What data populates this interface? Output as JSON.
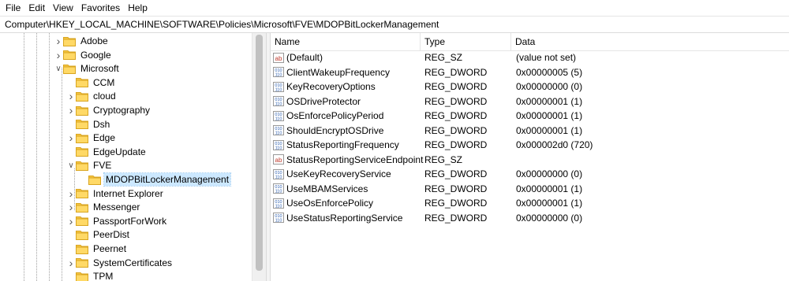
{
  "menu": [
    "File",
    "Edit",
    "View",
    "Favorites",
    "Help"
  ],
  "address": "Computer\\HKEY_LOCAL_MACHINE\\SOFTWARE\\Policies\\Microsoft\\FVE\\MDOPBitLockerManagement",
  "tree": [
    {
      "label": "Adobe",
      "level": 0,
      "expander": "collapsed"
    },
    {
      "label": "Google",
      "level": 0,
      "expander": "collapsed"
    },
    {
      "label": "Microsoft",
      "level": 0,
      "expander": "expanded"
    },
    {
      "label": "CCM",
      "level": 1,
      "expander": "none"
    },
    {
      "label": "cloud",
      "level": 1,
      "expander": "collapsed"
    },
    {
      "label": "Cryptography",
      "level": 1,
      "expander": "collapsed"
    },
    {
      "label": "Dsh",
      "level": 1,
      "expander": "none"
    },
    {
      "label": "Edge",
      "level": 1,
      "expander": "collapsed"
    },
    {
      "label": "EdgeUpdate",
      "level": 1,
      "expander": "none"
    },
    {
      "label": "FVE",
      "level": 1,
      "expander": "expanded"
    },
    {
      "label": "MDOPBitLockerManagement",
      "level": 2,
      "expander": "none",
      "selected": true
    },
    {
      "label": "Internet Explorer",
      "level": 1,
      "expander": "collapsed"
    },
    {
      "label": "Messenger",
      "level": 1,
      "expander": "collapsed"
    },
    {
      "label": "PassportForWork",
      "level": 1,
      "expander": "collapsed"
    },
    {
      "label": "PeerDist",
      "level": 1,
      "expander": "none"
    },
    {
      "label": "Peernet",
      "level": 1,
      "expander": "none"
    },
    {
      "label": "SystemCertificates",
      "level": 1,
      "expander": "collapsed"
    },
    {
      "label": "TPM",
      "level": 1,
      "expander": "none"
    }
  ],
  "columns": [
    "Name",
    "Type",
    "Data"
  ],
  "values": [
    {
      "name": "(Default)",
      "type": "REG_SZ",
      "data": "(value not set)",
      "icon": "string-value-icon"
    },
    {
      "name": "ClientWakeupFrequency",
      "type": "REG_DWORD",
      "data": "0x00000005 (5)",
      "icon": "binary-value-icon"
    },
    {
      "name": "KeyRecoveryOptions",
      "type": "REG_DWORD",
      "data": "0x00000000 (0)",
      "icon": "binary-value-icon"
    },
    {
      "name": "OSDriveProtector",
      "type": "REG_DWORD",
      "data": "0x00000001 (1)",
      "icon": "binary-value-icon"
    },
    {
      "name": "OsEnforcePolicyPeriod",
      "type": "REG_DWORD",
      "data": "0x00000001 (1)",
      "icon": "binary-value-icon"
    },
    {
      "name": "ShouldEncryptOSDrive",
      "type": "REG_DWORD",
      "data": "0x00000001 (1)",
      "icon": "binary-value-icon"
    },
    {
      "name": "StatusReportingFrequency",
      "type": "REG_DWORD",
      "data": "0x000002d0 (720)",
      "icon": "binary-value-icon"
    },
    {
      "name": "StatusReportingServiceEndpoint",
      "type": "REG_SZ",
      "data": "",
      "icon": "string-value-icon"
    },
    {
      "name": "UseKeyRecoveryService",
      "type": "REG_DWORD",
      "data": "0x00000000 (0)",
      "icon": "binary-value-icon"
    },
    {
      "name": "UseMBAMServices",
      "type": "REG_DWORD",
      "data": "0x00000001 (1)",
      "icon": "binary-value-icon"
    },
    {
      "name": "UseOsEnforcePolicy",
      "type": "REG_DWORD",
      "data": "0x00000001 (1)",
      "icon": "binary-value-icon"
    },
    {
      "name": "UseStatusReportingService",
      "type": "REG_DWORD",
      "data": "0x00000000 (0)",
      "icon": "binary-value-icon"
    }
  ],
  "colors": {
    "folder": "#f5c542",
    "folder_dark": "#d9a520",
    "selection": "#cce8ff",
    "string_icon": "#c0392b",
    "binary_icon": "#2a5db0"
  }
}
